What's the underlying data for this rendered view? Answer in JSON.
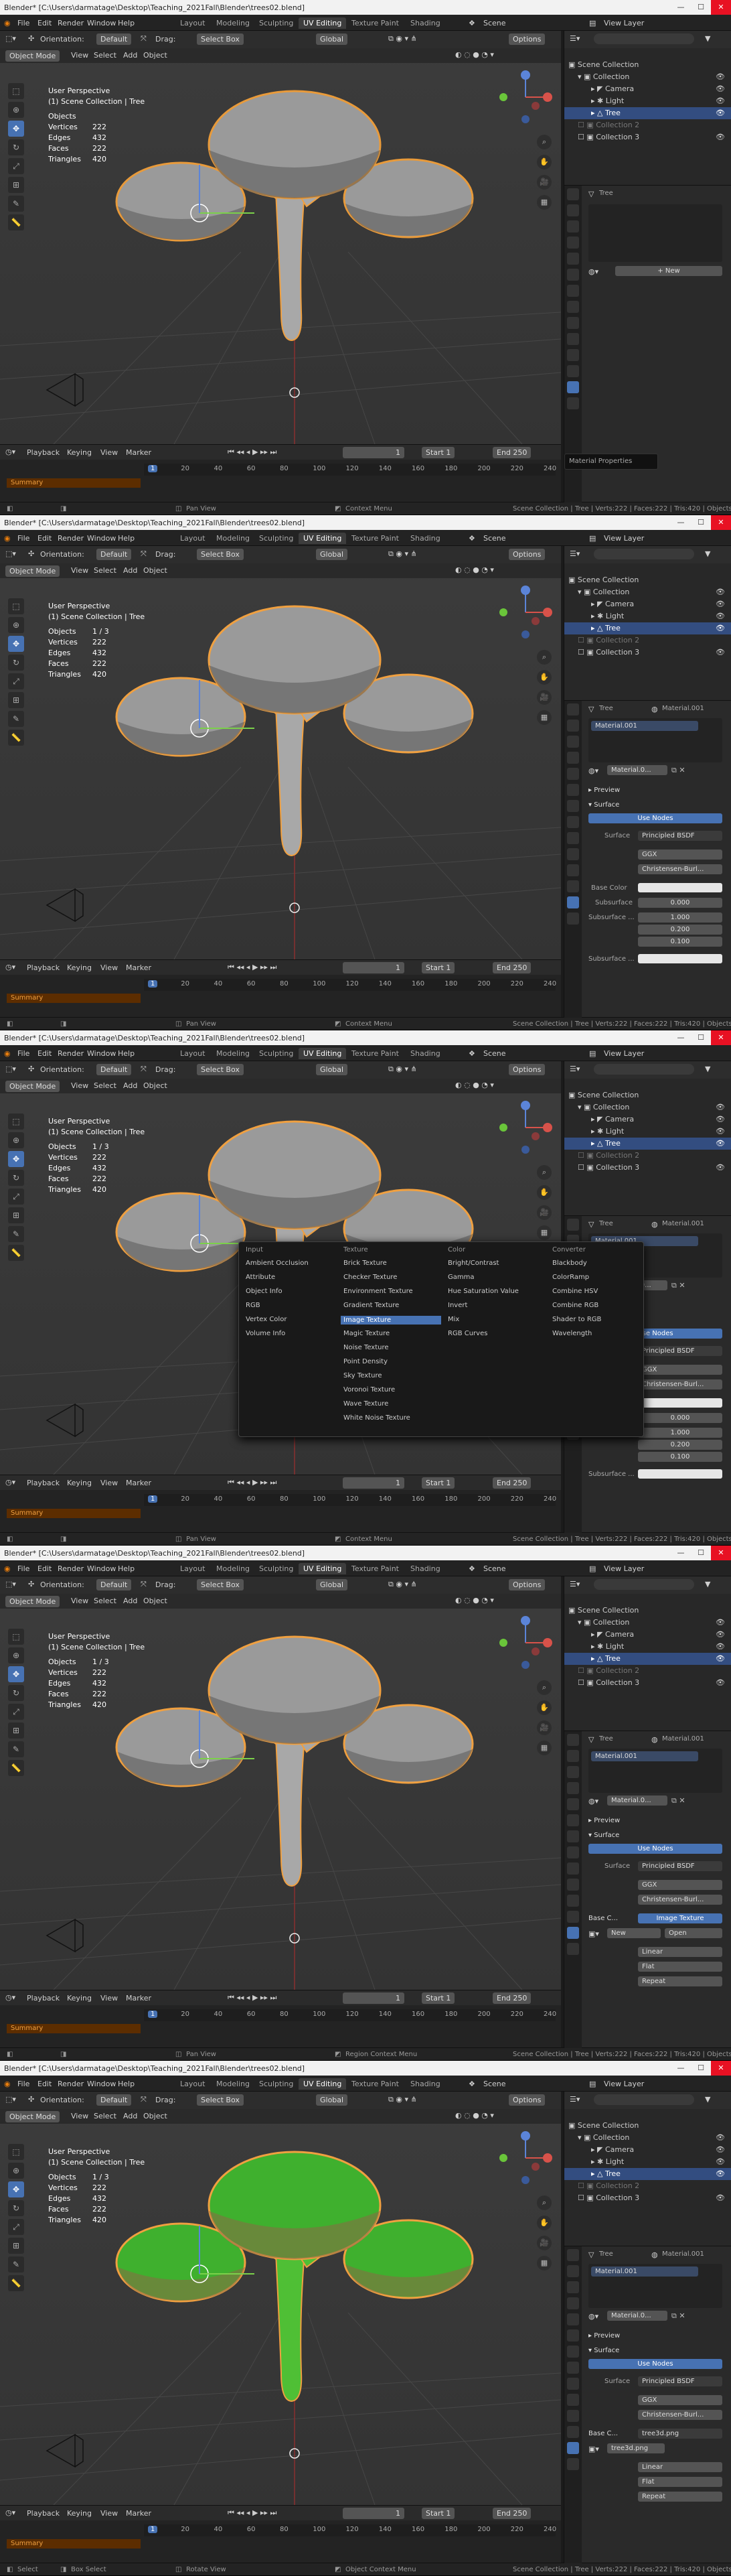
{
  "window": {
    "title": "Blender* [C:\\Users\\darmatage\\Desktop\\Teaching_2021Fall\\Blender\\trees02.blend]",
    "min": "—",
    "max": "☐",
    "close": "✕"
  },
  "menu": [
    "File",
    "Edit",
    "Render",
    "Window",
    "Help"
  ],
  "workspace_tabs": [
    "Layout",
    "Modeling",
    "Sculpting",
    "UV Editing",
    "Texture Paint",
    "Shading"
  ],
  "active_tab": "UV Editing",
  "scene": {
    "label": "Scene",
    "view_layer": "View Layer"
  },
  "header": {
    "orientation_label": "Orientation:",
    "orientation_value": "Default",
    "drag_label": "Drag:",
    "drag_value": "Select Box",
    "global": "Global",
    "options": "Options"
  },
  "header2": {
    "mode": "Object Mode",
    "view": "View",
    "select": "Select",
    "add": "Add",
    "object": "Object"
  },
  "stats": {
    "title": "User Perspective",
    "collection": "(1) Scene Collection | Tree",
    "objects_label": "Objects",
    "vertices_label": "Vertices",
    "edges_label": "Edges",
    "faces_label": "Faces",
    "triangles_label": "Triangles"
  },
  "frames": [
    {
      "objects": "",
      "vertices": "222",
      "edges": "432",
      "faces": "222",
      "triangles": "420",
      "status_middle": "Context Menu",
      "status_right": "Scene Collection | Tree | Verts:222 | Faces:222 | Tris:420 | Objects:1/3",
      "status_left": "Pan View"
    },
    {
      "objects": "1 / 3",
      "vertices": "222",
      "edges": "432",
      "faces": "222",
      "triangles": "420",
      "status_middle": "Context Menu",
      "status_right": "Scene Collection | Tree | Verts:222 | Faces:222 | Tris:420 | Objects:1/3",
      "status_left": "Pan View"
    },
    {
      "objects": "1 / 3",
      "vertices": "222",
      "edges": "432",
      "faces": "222",
      "triangles": "420",
      "status_middle": "Context Menu",
      "status_right": "Scene Collection | Tree | Verts:222 | Faces:222 | Tris:420 | Objects:1/3",
      "status_left": "Pan View"
    },
    {
      "objects": "1 / 3",
      "vertices": "222",
      "edges": "432",
      "faces": "222",
      "triangles": "420",
      "status_middle": "Region Context Menu",
      "status_right": "Scene Collection | Tree | Verts:222 | Faces:222 | Tris:420 | Objects:1/3",
      "status_left": "Pan View"
    },
    {
      "objects": "1 / 3",
      "vertices": "222",
      "edges": "432",
      "faces": "222",
      "triangles": "420",
      "status_middle": "Object Context Menu",
      "status_right": "Scene Collection | Tree | Verts:222 | Faces:222 | Tris:420 | Objects:1/3",
      "status_left": "Rotate View",
      "status_select": "Select",
      "status_box": "Box Select"
    }
  ],
  "timeline": {
    "playback": "Playback",
    "keying": "Keying",
    "view": "View",
    "marker": "Marker",
    "frame": "1",
    "start_label": "Start",
    "start": "1",
    "end_label": "End",
    "end": "250",
    "summary": "Summary",
    "ticks": [
      "1",
      "20",
      "40",
      "60",
      "80",
      "100",
      "120",
      "140",
      "160",
      "180",
      "200",
      "220",
      "240"
    ]
  },
  "outliner": {
    "scene_collection": "Scene Collection",
    "collection": "Collection",
    "camera": "Camera",
    "light": "Light",
    "tree": "Tree",
    "collection2": "Collection 2",
    "collection3": "Collection 3"
  },
  "props1": {
    "object": "Tree",
    "new": "New",
    "hint": "Material Properties"
  },
  "props": {
    "object": "Tree",
    "material": "Material.001",
    "slot": "Material.001",
    "mat_short": "Material.0...",
    "preview": "Preview",
    "surface": "Surface",
    "use_nodes": "Use Nodes",
    "surface_label": "Surface",
    "surface_value": "Principled BSDF",
    "ggx": "GGX",
    "christensen": "Christensen-Burl...",
    "base_color": "Base Color",
    "subsurface": "Subsurface",
    "subsurface_val": "0.000",
    "subsurface_radius": "Subsurface ...",
    "r1": "1.000",
    "r2": "0.200",
    "r3": "0.100",
    "subsurface_color": "Subsurface ...",
    "base_c": "Base C...",
    "image_texture": "Image Texture",
    "tree3d": "tree3d.png",
    "new": "New",
    "open": "Open",
    "linear": "Linear",
    "flat": "Flat",
    "repeat": "Repeat",
    "tree3d_png": "tree3d.png"
  },
  "popup": {
    "input": {
      "header": "Input",
      "items": [
        "Ambient Occlusion",
        "Attribute",
        "Object Info",
        "RGB",
        "Vertex Color",
        "Volume Info"
      ]
    },
    "texture": {
      "header": "Texture",
      "items": [
        "Brick Texture",
        "Checker Texture",
        "Environment Texture",
        "Gradient Texture",
        "Image Texture",
        "Magic Texture",
        "Noise Texture",
        "Point Density",
        "Sky Texture",
        "Voronoi Texture",
        "Wave Texture",
        "White Noise Texture"
      ]
    },
    "color": {
      "header": "Color",
      "items": [
        "Bright/Contrast",
        "Gamma",
        "Hue Saturation Value",
        "Invert",
        "Mix",
        "RGB Curves"
      ]
    },
    "converter": {
      "header": "Converter",
      "items": [
        "Blackbody",
        "ColorRamp",
        "Combine HSV",
        "Combine RGB",
        "Shader to RGB",
        "Wavelength"
      ]
    },
    "highlight": "Image Texture"
  },
  "colors": {
    "accent": "#4772b3",
    "tree_gray": "#9a9a9a",
    "tree_green": "#3fb02e",
    "outline": "#f0a040"
  }
}
